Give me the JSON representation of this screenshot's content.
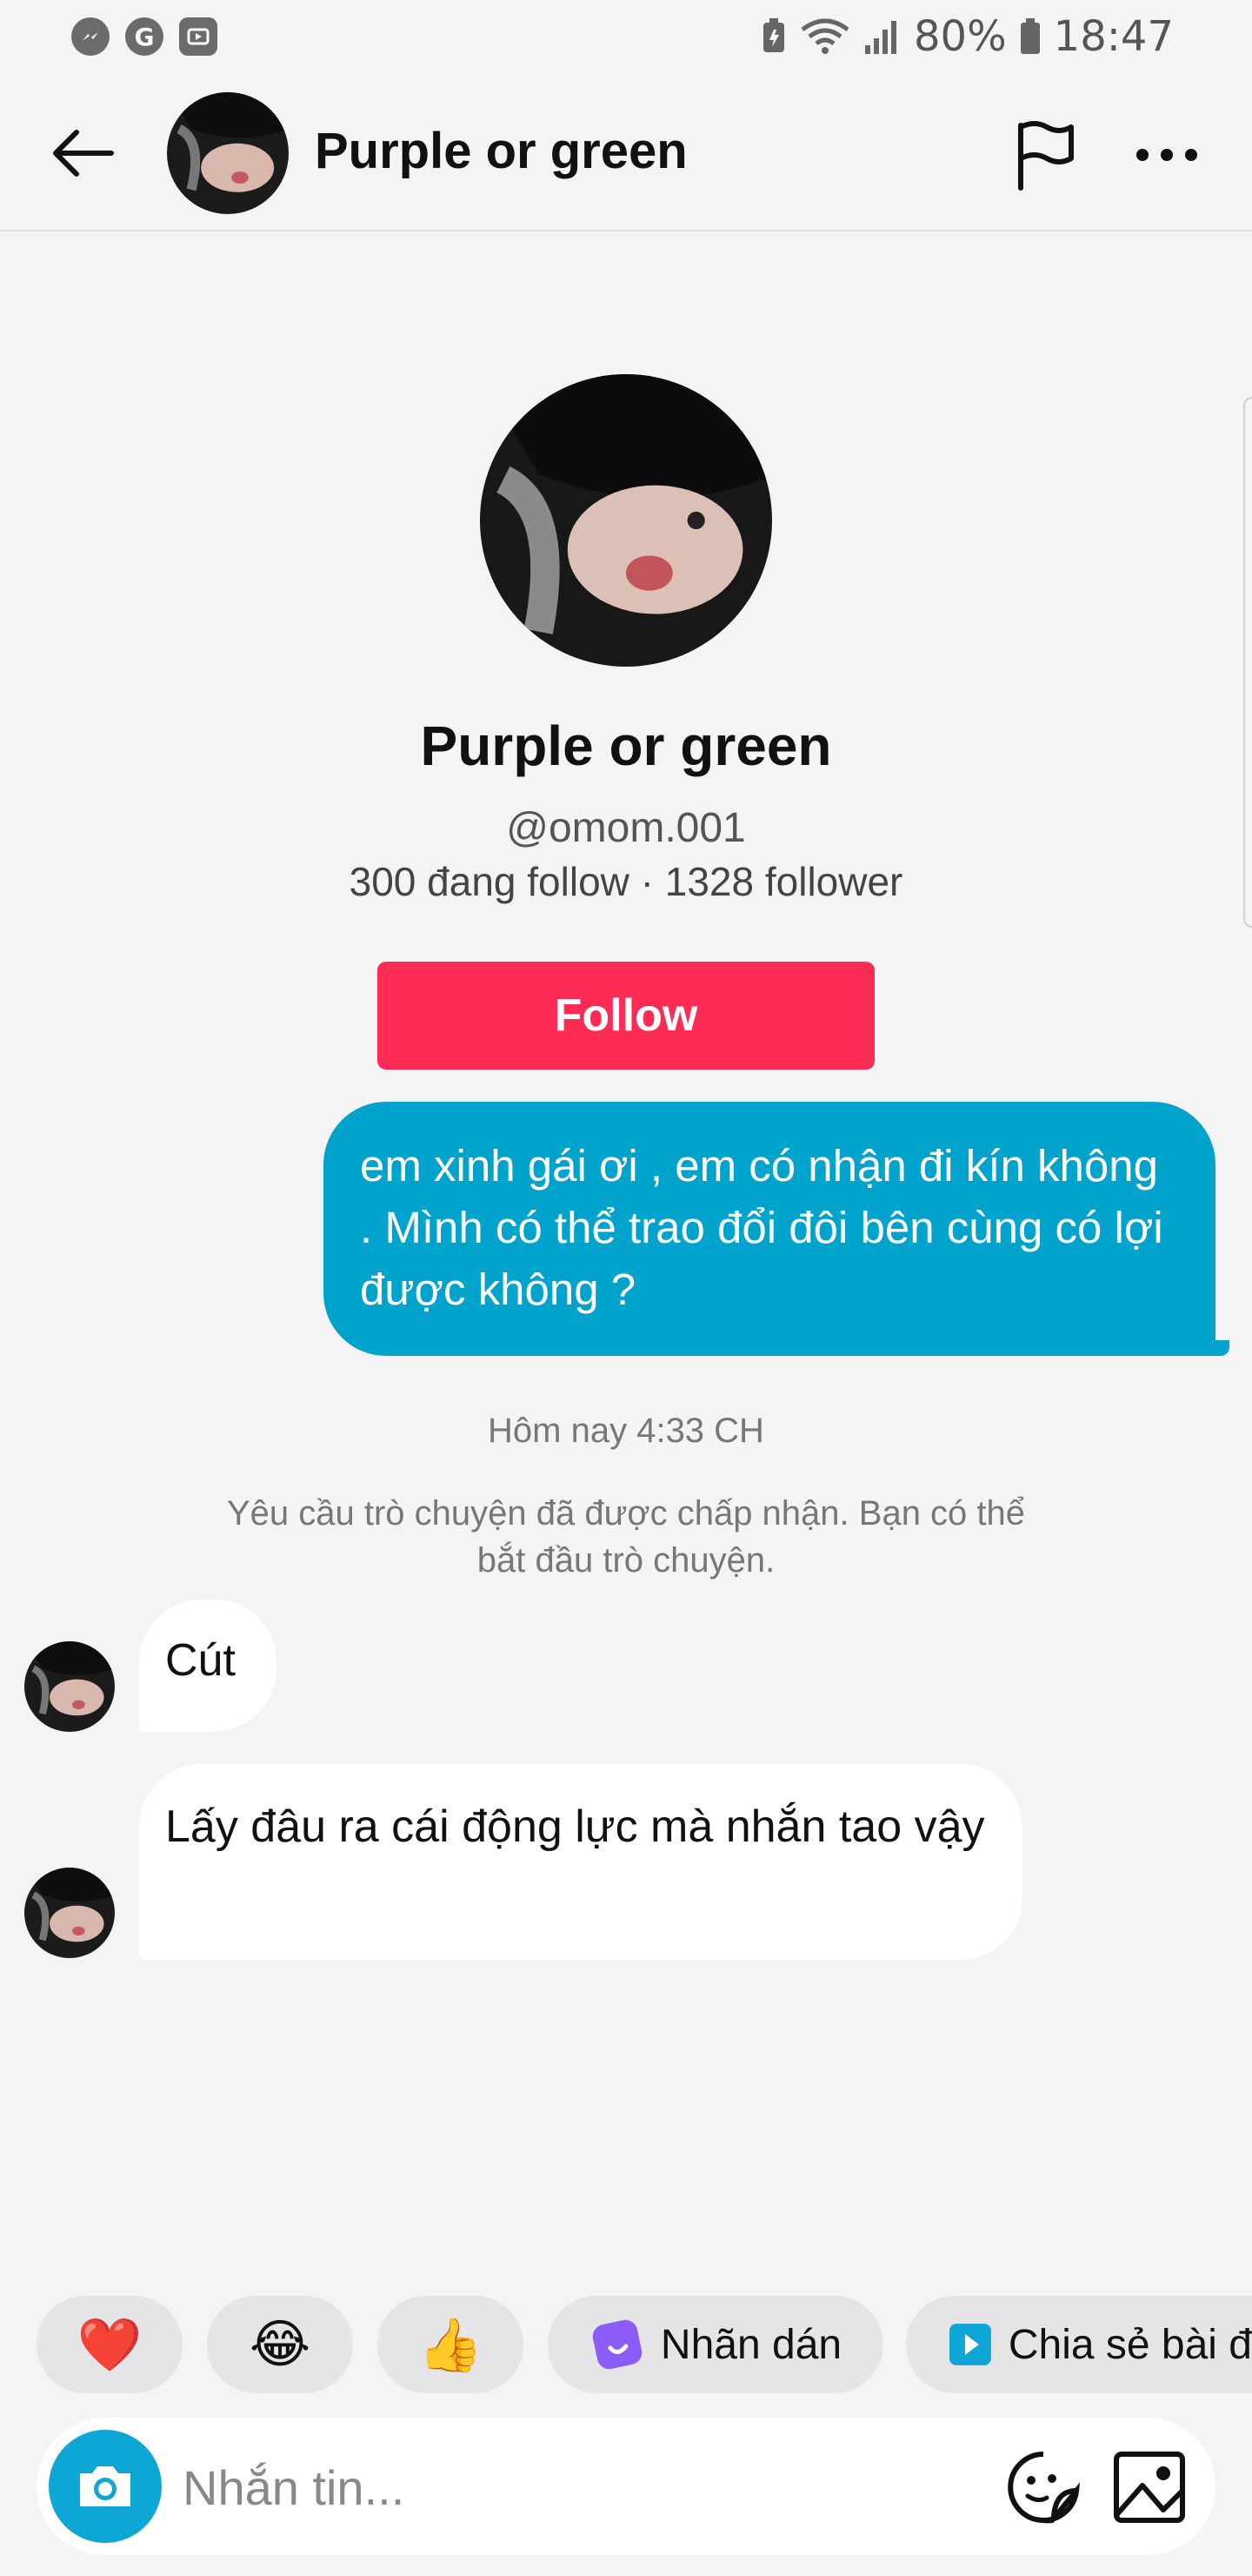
{
  "status_bar": {
    "battery_percent": "80%",
    "time": "18:47",
    "left_icons": [
      "messenger-icon",
      "google-icon",
      "screen-recorder-icon"
    ],
    "right_icons": [
      "battery-saver-icon",
      "wifi-icon",
      "signal-icon",
      "battery-icon"
    ]
  },
  "header": {
    "title": "Purple or green",
    "icons": [
      "back-arrow-icon",
      "flag-icon",
      "more-icon"
    ]
  },
  "profile": {
    "name": "Purple or green",
    "handle": "@omom.001",
    "stats": "300 đang follow · 1328 follower",
    "follow_label": "Follow"
  },
  "messages": {
    "outgoing": "em xinh gái ơi , em có nhận đi kín không . Mình có thể trao đổi đôi bên cùng có lợi được không ?",
    "timestamp": "Hôm nay 4:33 CH",
    "system": "Yêu cầu trò chuyện đã được chấp nhận. Bạn có thể bắt đầu trò chuyện.",
    "incoming": [
      "Cút",
      "Lấy đâu ra cái động lực mà nhắn tao vậy"
    ]
  },
  "quick_replies": {
    "heart": "❤️",
    "laugh": "😂",
    "thumbs": "👍",
    "sticker_label": "Nhãn dán",
    "share_label": "Chia sẻ bài đ"
  },
  "composer": {
    "placeholder": "Nhắn tin..."
  },
  "colors": {
    "accent_red": "#fe2c55",
    "bubble_blue": "#00a3cc",
    "camera_blue": "#0ea6d4"
  }
}
